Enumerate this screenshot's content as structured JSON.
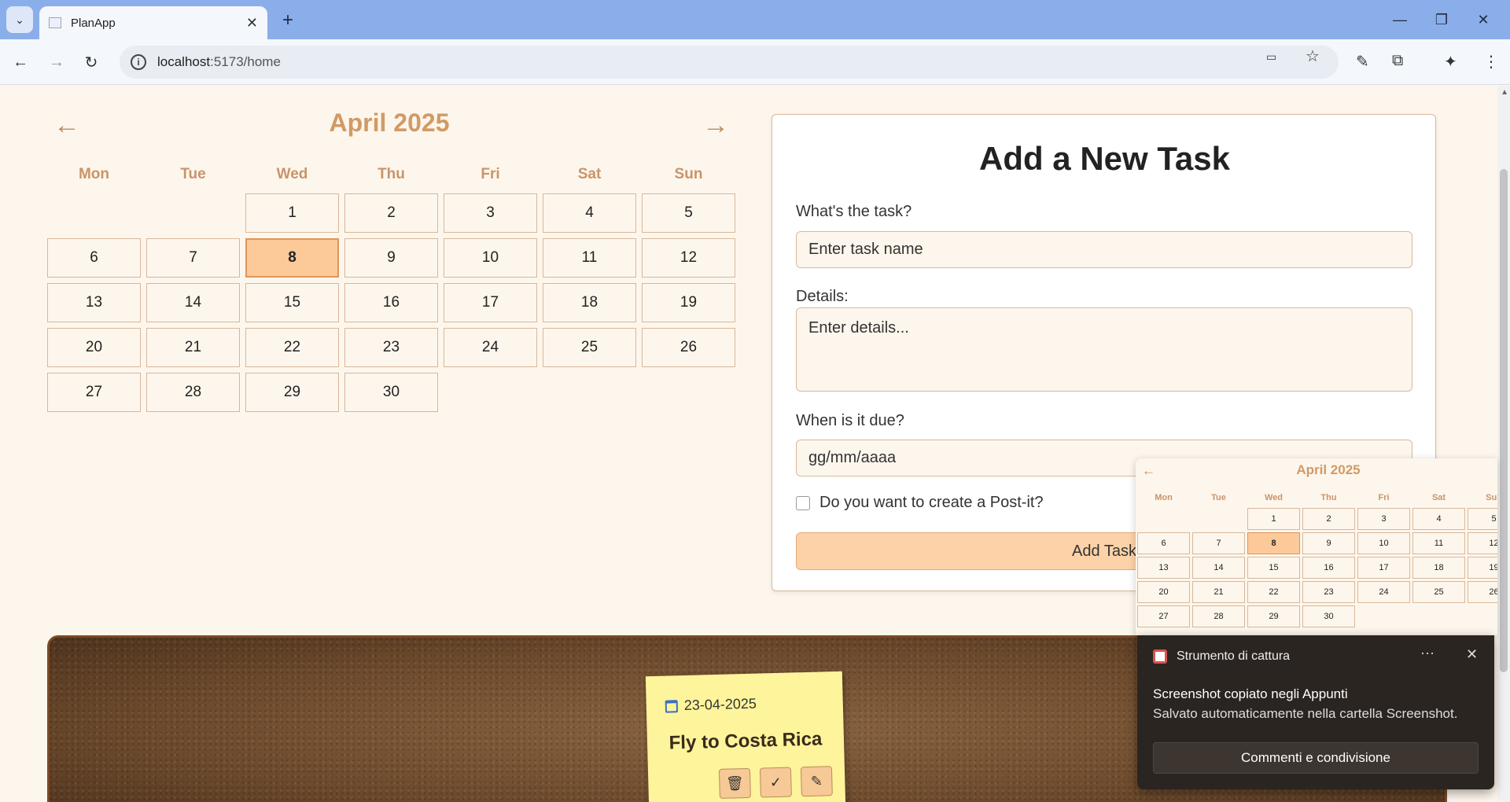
{
  "browser": {
    "tab_title": "PlanApp",
    "url_host": "localhost",
    "url_path": ":5173/home"
  },
  "calendar": {
    "month_label": "April 2025",
    "prev_arrow": "←",
    "next_arrow": "→",
    "weekdays": [
      "Mon",
      "Tue",
      "Wed",
      "Thu",
      "Fri",
      "Sat",
      "Sun"
    ],
    "leading_blanks": 2,
    "days": [
      "1",
      "2",
      "3",
      "4",
      "5",
      "6",
      "7",
      "8",
      "9",
      "10",
      "11",
      "12",
      "13",
      "14",
      "15",
      "16",
      "17",
      "18",
      "19",
      "20",
      "21",
      "22",
      "23",
      "24",
      "25",
      "26",
      "27",
      "28",
      "29",
      "30"
    ],
    "today": "8"
  },
  "form": {
    "title": "Add a New Task",
    "task_label": "What's the task?",
    "task_placeholder": "Enter task name",
    "details_label": "Details:",
    "details_placeholder": "Enter details...",
    "due_label": "When is it due?",
    "due_placeholder": "gg/mm/aaaa",
    "postit_label": "Do you want to create a Post-it?",
    "submit_label": "Add Task"
  },
  "postit": {
    "date": "23-04-2025",
    "title": "Fly to Costa Rica"
  },
  "picker": {
    "month_label": "April 2025",
    "prev_arrow": "←"
  },
  "toast": {
    "app_name": "Strumento di cattura",
    "more": "···",
    "close": "✕",
    "title": "Screenshot copiato negli Appunti",
    "body": "Salvato automaticamente nella cartella Screenshot.",
    "action": "Commenti e condivisione"
  }
}
